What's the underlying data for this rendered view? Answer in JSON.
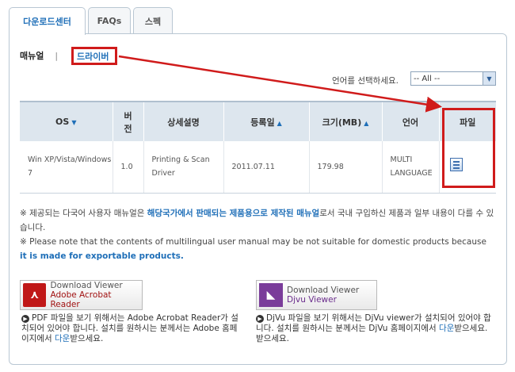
{
  "tabs": [
    {
      "label": "다운로드센터",
      "active": true
    },
    {
      "label": "FAQs",
      "active": false
    },
    {
      "label": "스펙",
      "active": false
    }
  ],
  "subnav": {
    "manual": "매뉴얼",
    "separator": "|",
    "driver": "드라이버"
  },
  "language": {
    "label": "언어를 선택하세요.",
    "selected": "-- All --"
  },
  "table": {
    "headers": {
      "os": "OS",
      "version": "버전",
      "description": "상세설명",
      "date": "등록일",
      "size": "크기(MB)",
      "lang": "언어",
      "file": "파일"
    },
    "row": {
      "os": "Win XP/Vista/Windows 7",
      "version": "1.0",
      "description": "Printing & Scan Driver",
      "date": "2011.07.11",
      "size": "179.98",
      "lang": "MULTI LANGUAGE"
    }
  },
  "notes": {
    "ko_a": "※ 제공되는 다국어 사용자 매뉴얼은 ",
    "ko_hl": "해당국가에서 판매되는 제품용으로 제작된 매뉴얼",
    "ko_b": "로서 국내 구입하신 제품과 일부 내용이 다를 수 있습니다.",
    "en_a": "※ Please note that the contents of multilingual user manual may be not suitable for domestic products because ",
    "en_hl": "it is made for exportable products."
  },
  "viewers": {
    "acrobat": {
      "line1": "Download Viewer",
      "line2": "Adobe Acrobat Reader"
    },
    "djvu": {
      "line1": "Download Viewer",
      "line2": "Djvu Viewer"
    }
  },
  "descriptions": {
    "acrobat_a": "PDF 파일을 보기 위해서는 Adobe Acrobat Reader가 설치되어 있어야 합니다. 설치를 원하시는 분께서는 Adobe 홈페이지에서 ",
    "acrobat_link": "다운",
    "acrobat_b": "받으세요.",
    "djvu_a": "DjVu 파일을 보기 위해서는 DjVu viewer가 설치되어 있어야 합니다. 설치를 원하시는 분께서는 DjVu 홈페이지에서 ",
    "djvu_link": "다운",
    "djvu_b": "받으세요.받으세요."
  },
  "colors": {
    "accent": "#1f6fb8",
    "highlight_red": "#d01b1b",
    "header_bg": "#dde6ee"
  }
}
